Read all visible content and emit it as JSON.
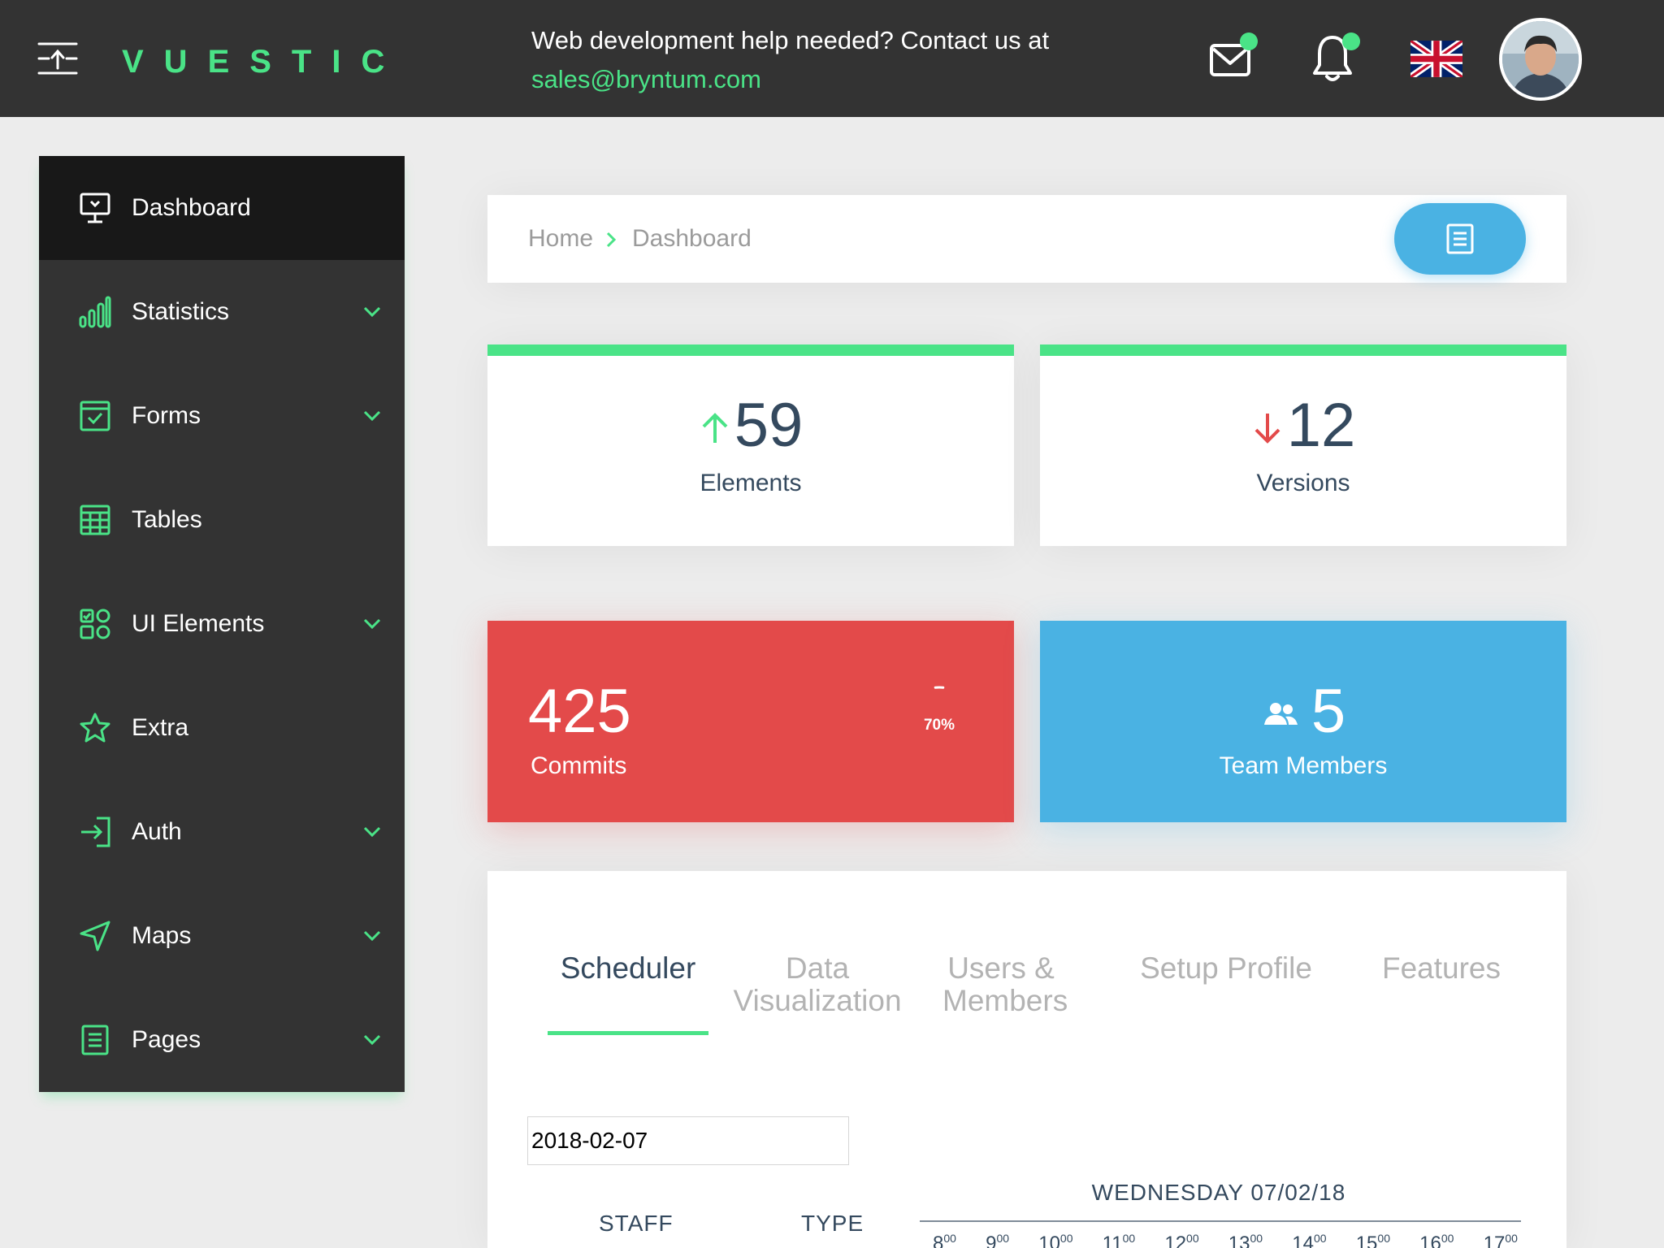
{
  "topbar": {
    "logo": "VUESTIC",
    "help_text": "Web development help needed? Contact us at ",
    "help_email": "sales@bryntum.com",
    "icons": [
      "menu-toggle-icon",
      "mail-icon",
      "bell-icon",
      "uk-flag-icon",
      "avatar"
    ]
  },
  "sidebar": {
    "items": [
      {
        "label": "Dashboard",
        "icon": "monitor-icon",
        "active": true
      },
      {
        "label": "Statistics",
        "icon": "bar-chart-icon",
        "has_children": true
      },
      {
        "label": "Forms",
        "icon": "form-checkbox-icon",
        "has_children": true
      },
      {
        "label": "Tables",
        "icon": "table-icon",
        "has_children": false
      },
      {
        "label": "UI Elements",
        "icon": "ui-elements-icon",
        "has_children": true
      },
      {
        "label": "Extra",
        "icon": "star-icon",
        "has_children": false
      },
      {
        "label": "Auth",
        "icon": "login-icon",
        "has_children": true
      },
      {
        "label": "Maps",
        "icon": "navigation-icon",
        "has_children": true
      },
      {
        "label": "Pages",
        "icon": "document-icon",
        "has_children": true
      }
    ]
  },
  "breadcrumb": {
    "home": "Home",
    "current": "Dashboard"
  },
  "stats": {
    "elements": {
      "value": "59",
      "label": "Elements",
      "trend": "up"
    },
    "versions": {
      "value": "12",
      "label": "Versions",
      "trend": "down"
    },
    "commits": {
      "value": "425",
      "label": "Commits",
      "progress_label": "70%",
      "progress": 0.7
    },
    "team": {
      "value": "5",
      "label": "Team Members"
    }
  },
  "tabs": {
    "items": [
      {
        "line1": "Scheduler",
        "line2": "",
        "active": true
      },
      {
        "line1": "Data",
        "line2": "Visualization",
        "active": false
      },
      {
        "line1": "Users &",
        "line2": "Members",
        "active": false
      },
      {
        "line1": "Setup Profile",
        "line2": "",
        "active": false
      },
      {
        "line1": "Features",
        "line2": "",
        "active": false
      }
    ]
  },
  "scheduler": {
    "date_value": "2018-02-07",
    "day_header": "WEDNESDAY 07/02/18",
    "columns": [
      "STAFF",
      "TYPE"
    ],
    "hours": [
      "8",
      "9",
      "10",
      "11",
      "12",
      "13",
      "14",
      "15",
      "16",
      "17"
    ],
    "hour_suffix": "00"
  },
  "colors": {
    "accent": "#4ae387",
    "danger": "#e34a4a",
    "info": "#4ab2e3",
    "dark": "#333333",
    "text": "#34495e"
  }
}
